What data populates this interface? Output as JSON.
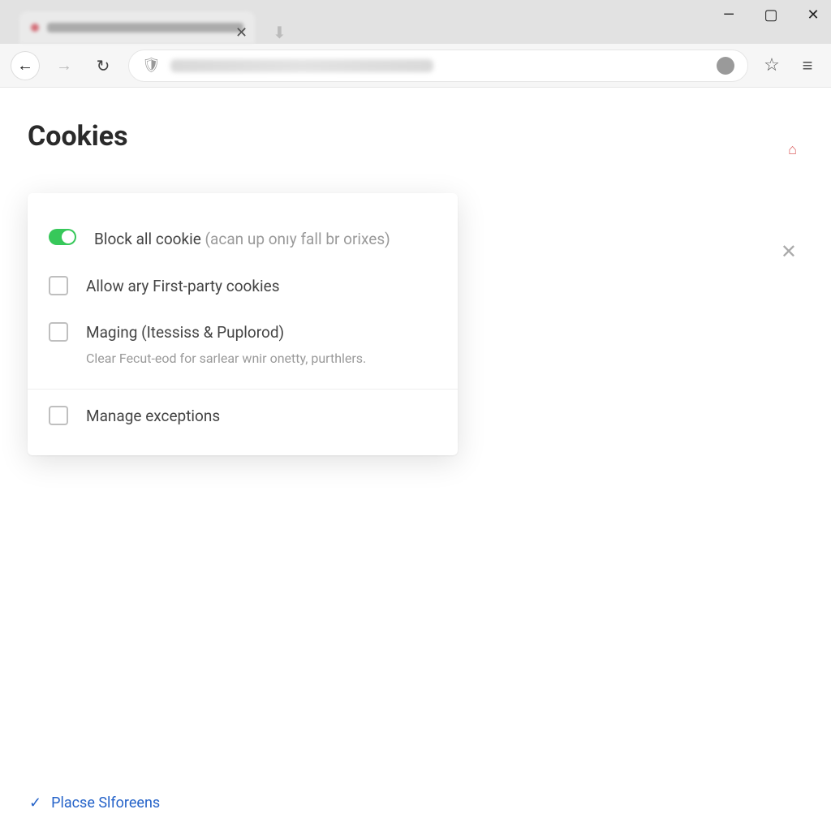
{
  "window": {
    "title": ""
  },
  "page": {
    "title": "Cookies"
  },
  "settings": {
    "block_all": {
      "label": "Block all cookie",
      "hint": "(acan up onıy fall br orixes)",
      "enabled": true
    },
    "allow_first_party": {
      "label": "Allow ary First-party cookies",
      "enabled": false
    },
    "maging": {
      "label": "Maging (Itessiss & Puplorod)",
      "enabled": false,
      "sub": "Clear Fecut-eod for sarlear wnir onetty, purthlers."
    },
    "manage_exceptions": {
      "label": "Manage exceptions",
      "enabled": false
    }
  },
  "footer": {
    "link": "Placse Slforeens"
  },
  "icons": {
    "back": "←",
    "forward": "→",
    "reload": "↻",
    "shield": "🛡",
    "bookmark": "☆",
    "menu": "≡",
    "download": "⬇",
    "close": "✕",
    "minimize": "—",
    "maximize": "▢",
    "home": "⌂",
    "check": "✓"
  }
}
